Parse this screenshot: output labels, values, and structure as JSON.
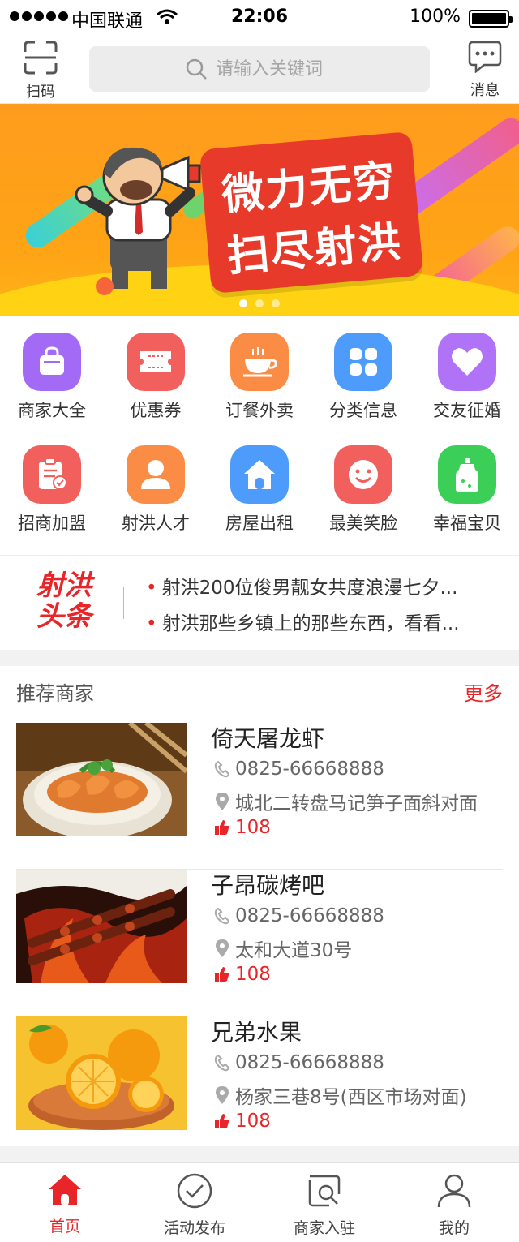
{
  "status_bar": {
    "carrier": "中国联通",
    "time": "22:06",
    "battery": "100%"
  },
  "header": {
    "scan_label": "扫码",
    "search_placeholder": "请输入关键词",
    "message_label": "消息"
  },
  "banner": {
    "line1": "微力无穷",
    "line2": "扫尽射洪",
    "slide_count": 3,
    "active_slide": 1
  },
  "categories": [
    {
      "label": "商家大全",
      "icon": "shopping-bag-icon",
      "color": "#a36bf5"
    },
    {
      "label": "优惠券",
      "icon": "ticket-icon",
      "color": "#f2605e"
    },
    {
      "label": "订餐外卖",
      "icon": "coffee-cup-icon",
      "color": "#fb8c45"
    },
    {
      "label": "分类信息",
      "icon": "grid-icon",
      "color": "#4d9cfb"
    },
    {
      "label": "交友征婚",
      "icon": "heart-icon",
      "color": "#b072f7"
    },
    {
      "label": "招商加盟",
      "icon": "clipboard-icon",
      "color": "#f2605e"
    },
    {
      "label": "射洪人才",
      "icon": "person-icon",
      "color": "#fb8c45"
    },
    {
      "label": "房屋出租",
      "icon": "house-icon",
      "color": "#4d9cfb"
    },
    {
      "label": "最美笑脸",
      "icon": "smile-icon",
      "color": "#f2605e"
    },
    {
      "label": "幸福宝贝",
      "icon": "baby-bottle-icon",
      "color": "#3ccf58"
    }
  ],
  "headlines": {
    "logo_line1": "射洪",
    "logo_line2": "头条",
    "items": [
      "射洪200位俊男靓女共度浪漫七夕...",
      "射洪那些乡镇上的那些东西，看看..."
    ]
  },
  "recommend": {
    "title": "推荐商家",
    "more": "更多",
    "shops": [
      {
        "name": "倚天屠龙虾",
        "phone": "0825-66668888",
        "address": "城北二转盘马记笋子面斜对面",
        "likes": "108",
        "image": "shrimp-dish"
      },
      {
        "name": "子昂碳烤吧",
        "phone": "0825-66668888",
        "address": "太和大道30号",
        "likes": "108",
        "image": "grilled-skewers"
      },
      {
        "name": "兄弟水果",
        "phone": "0825-66668888",
        "address": "杨家三巷8号(西区市场对面)",
        "likes": "108",
        "image": "oranges"
      }
    ]
  },
  "tabbar": [
    {
      "label": "首页",
      "icon": "home-icon",
      "active": true
    },
    {
      "label": "活动发布",
      "icon": "check-circle-icon",
      "active": false
    },
    {
      "label": "商家入驻",
      "icon": "store-search-icon",
      "active": false
    },
    {
      "label": "我的",
      "icon": "user-icon",
      "active": false
    }
  ],
  "colors": {
    "accent": "#e8262a",
    "banner": "#ffa415"
  }
}
